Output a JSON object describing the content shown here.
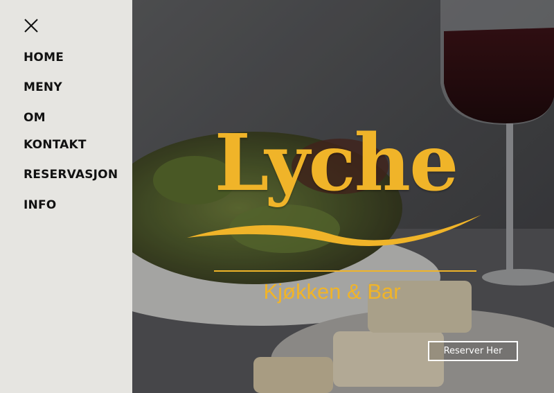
{
  "sidebar": {
    "close_icon": "close-icon",
    "items": [
      {
        "label": "HOME"
      },
      {
        "label": "MENY"
      },
      {
        "label": "OM"
      },
      {
        "label": "KONTAKT"
      },
      {
        "label": "RESERVASJON"
      },
      {
        "label": "INFO"
      }
    ]
  },
  "hero": {
    "logo_text": "Lyche",
    "tagline": "Kjøkken & Bar",
    "cta_label": "Reserver Her"
  },
  "colors": {
    "sidebar_bg": "#e6e5e1",
    "accent": "#f0b429",
    "nav_text": "#111111"
  }
}
